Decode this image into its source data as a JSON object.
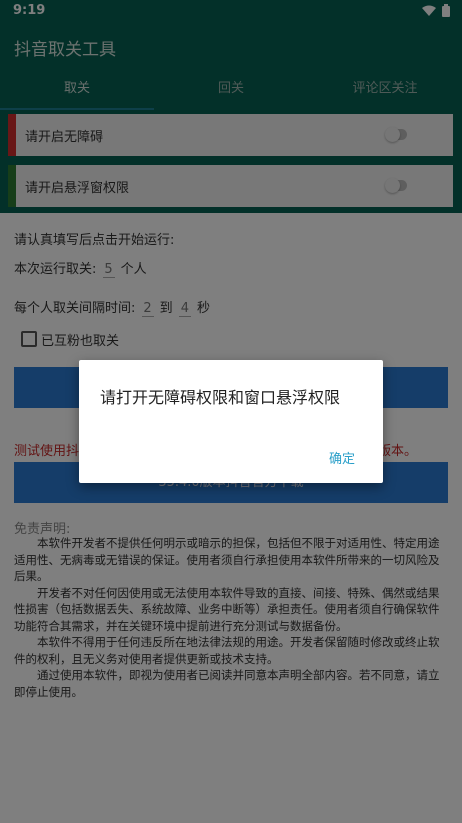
{
  "status": {
    "time": "9:19"
  },
  "app": {
    "title": "抖音取关工具"
  },
  "tabs": [
    {
      "label": "取关",
      "active": true
    },
    {
      "label": "回关",
      "active": false
    },
    {
      "label": "评论区关注",
      "active": false
    }
  ],
  "permissions": [
    {
      "label": "请开启无障碍",
      "color": "#d32f2f"
    },
    {
      "label": "请开启悬浮窗权限",
      "color": "#2e7d32"
    }
  ],
  "form": {
    "intro": "请认真填写后点击开始运行:",
    "count_prefix": "本次运行取关:",
    "count_value": "5",
    "count_suffix": "个人",
    "interval_prefix": "每个人取关间隔时间:",
    "interval_min": "2",
    "interval_to": "到",
    "interval_max": "4",
    "interval_unit": "秒",
    "mutual_label": "已互粉也取关"
  },
  "background": {
    "test_left": "测试使用抖",
    "test_right": "版本。",
    "download_btn": "35.4.0版本抖音官方下载"
  },
  "disclaimer": {
    "title": "免责声明:",
    "paragraphs": [
      "本软件开发者不提供任何明示或暗示的担保，包括但不限于对适用性、特定用途适用性、无病毒或无错误的保证。使用者须自行承担使用本软件所带来的一切风险及后果。",
      "开发者不对任何因使用或无法使用本软件导致的直接、间接、特殊、偶然或结果性损害（包括数据丢失、系统故障、业务中断等）承担责任。使用者须自行确保软件功能符合其需求，并在关键环境中提前进行充分测试与数据备份。",
      "本软件不得用于任何违反所在地法律法规的用途。开发者保留随时修改或终止软件的权利，且无义务对使用者提供更新或技术支持。",
      "通过使用本软件，即视为使用者已阅读并同意本声明全部内容。若不同意，请立即停止使用。"
    ]
  },
  "dialog": {
    "message": "请打开无障碍权限和窗口悬浮权限",
    "confirm": "确定"
  }
}
